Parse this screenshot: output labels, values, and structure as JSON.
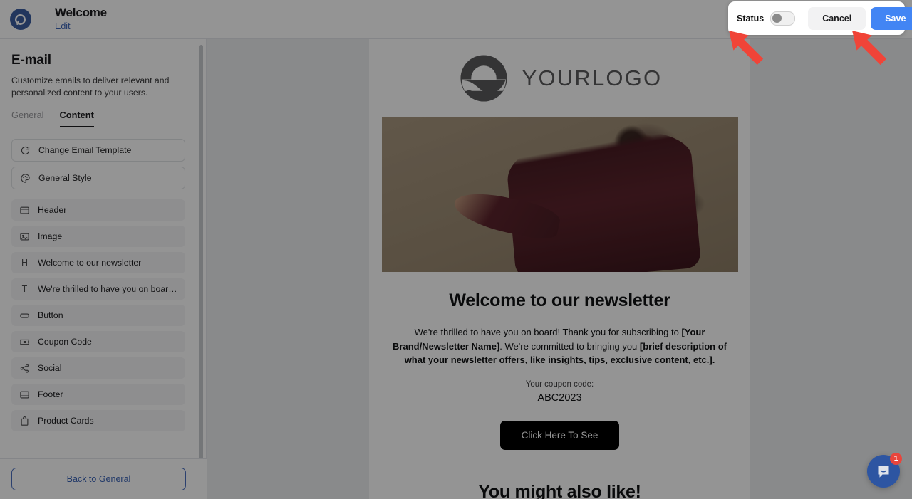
{
  "header": {
    "logo_icon": "app-logo-icon",
    "title": "Welcome",
    "edit_link": "Edit"
  },
  "action_card": {
    "status_label": "Status",
    "status_value": "off",
    "cancel_label": "Cancel",
    "save_label": "Save",
    "save_color": "#4285f4"
  },
  "annotations": {
    "arrow_color": "#f04438",
    "arrows": [
      {
        "name": "arrow-to-status-toggle"
      },
      {
        "name": "arrow-to-save-button"
      }
    ]
  },
  "sidebar": {
    "title": "E-mail",
    "description": "Customize emails to deliver relevant and personalized content to your users.",
    "tabs": [
      {
        "label": "General",
        "active": false
      },
      {
        "label": "Content",
        "active": true
      }
    ],
    "actions": [
      {
        "label": "Change Email Template",
        "icon": "refresh-icon"
      },
      {
        "label": "General Style",
        "icon": "palette-icon"
      }
    ],
    "blocks": [
      {
        "label": "Header",
        "icon": "header-icon"
      },
      {
        "label": "Image",
        "icon": "image-icon"
      },
      {
        "label": "Welcome to our newsletter",
        "icon": "heading-letter-icon"
      },
      {
        "label": "We're thrilled to have you on board! Tha...",
        "icon": "text-letter-icon"
      },
      {
        "label": "Button",
        "icon": "button-icon"
      },
      {
        "label": "Coupon Code",
        "icon": "ticket-icon"
      },
      {
        "label": "Social",
        "icon": "share-icon"
      },
      {
        "label": "Footer",
        "icon": "footer-icon"
      },
      {
        "label": "Product Cards",
        "icon": "bag-icon"
      }
    ],
    "back_button": "Back to General"
  },
  "email_preview": {
    "logo_text": "YOURLOGO",
    "logo_icon": "circle-wave-logo-icon",
    "hero_image": "woman-in-burgundy-suit-photo",
    "heading": "Welcome to our newsletter",
    "body_parts": [
      {
        "text": "We're thrilled to have you on board! Thank you for subscribing to ",
        "bold": false
      },
      {
        "text": "[Your Brand/Newsletter Name]",
        "bold": true
      },
      {
        "text": ". We're committed to bringing you ",
        "bold": false
      },
      {
        "text": "[brief description of what your newsletter offers, like insights, tips, exclusive content, etc.].",
        "bold": true
      }
    ],
    "coupon_label": "Your coupon code:",
    "coupon_code": "ABC2023",
    "cta_label": "Click Here To See",
    "section_heading": "You might also like!"
  },
  "chat": {
    "icon": "chat-bubble-icon",
    "badge_count": "1"
  }
}
